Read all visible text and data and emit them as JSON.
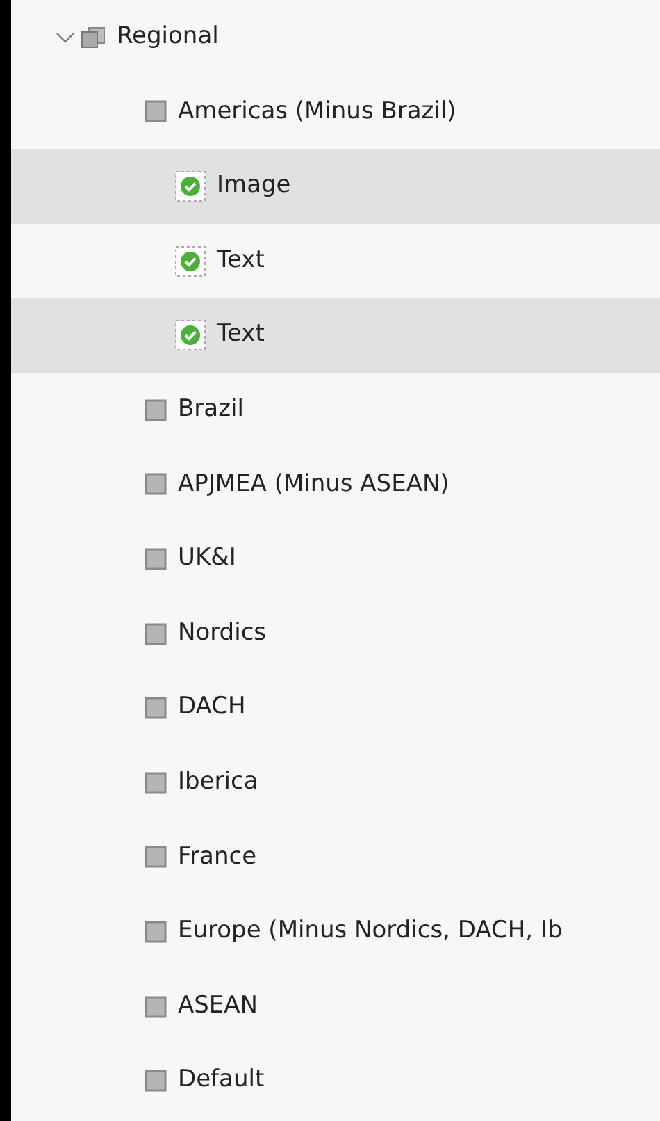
{
  "tree": [
    {
      "label": "Regional",
      "kind": "folder",
      "expanded": true,
      "selected": false,
      "children": [
        {
          "label": "Americas (Minus Brazil)",
          "kind": "group",
          "selected": false,
          "children": [
            {
              "label": "Image",
              "kind": "item",
              "selected": true
            },
            {
              "label": "Text",
              "kind": "item",
              "selected": false
            },
            {
              "label": "Text",
              "kind": "item",
              "selected": true
            }
          ]
        },
        {
          "label": "Brazil",
          "kind": "group",
          "selected": false
        },
        {
          "label": "APJMEA (Minus ASEAN)",
          "kind": "group",
          "selected": false
        },
        {
          "label": "UK&I",
          "kind": "group",
          "selected": false
        },
        {
          "label": "Nordics",
          "kind": "group",
          "selected": false
        },
        {
          "label": "DACH",
          "kind": "group",
          "selected": false
        },
        {
          "label": "Iberica",
          "kind": "group",
          "selected": false
        },
        {
          "label": "France",
          "kind": "group",
          "selected": false
        },
        {
          "label": "Europe (Minus Nordics, DACH, Ib",
          "kind": "group",
          "selected": false
        },
        {
          "label": "ASEAN",
          "kind": "group",
          "selected": false
        },
        {
          "label": "Default",
          "kind": "group",
          "selected": false
        }
      ]
    }
  ]
}
